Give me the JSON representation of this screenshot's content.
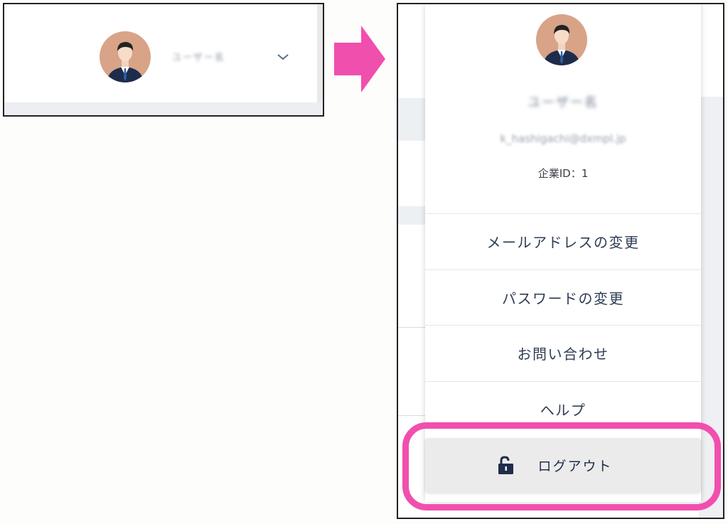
{
  "header_collapsed": {
    "username": "ユーザー名",
    "avatar_icon": "user-avatar-icon",
    "dropdown_icon": "chevron-down-icon"
  },
  "arrow_icon": "right-arrow-icon",
  "account_menu": {
    "username": "ユーザー名",
    "email": "k_hashigachi@dxmpl.jp",
    "company_id": "企業ID：1",
    "items": [
      {
        "label": "メールアドレスの変更"
      },
      {
        "label": "パスワードの変更"
      },
      {
        "label": "お問い合わせ"
      },
      {
        "label": "ヘルプ"
      }
    ],
    "logout": {
      "label": "ログアウト",
      "icon": "unlock-icon"
    }
  },
  "colors": {
    "accent_pink": "#f14fae",
    "navy": "#1f2d4a",
    "avatar_bg": "#d9a387"
  }
}
